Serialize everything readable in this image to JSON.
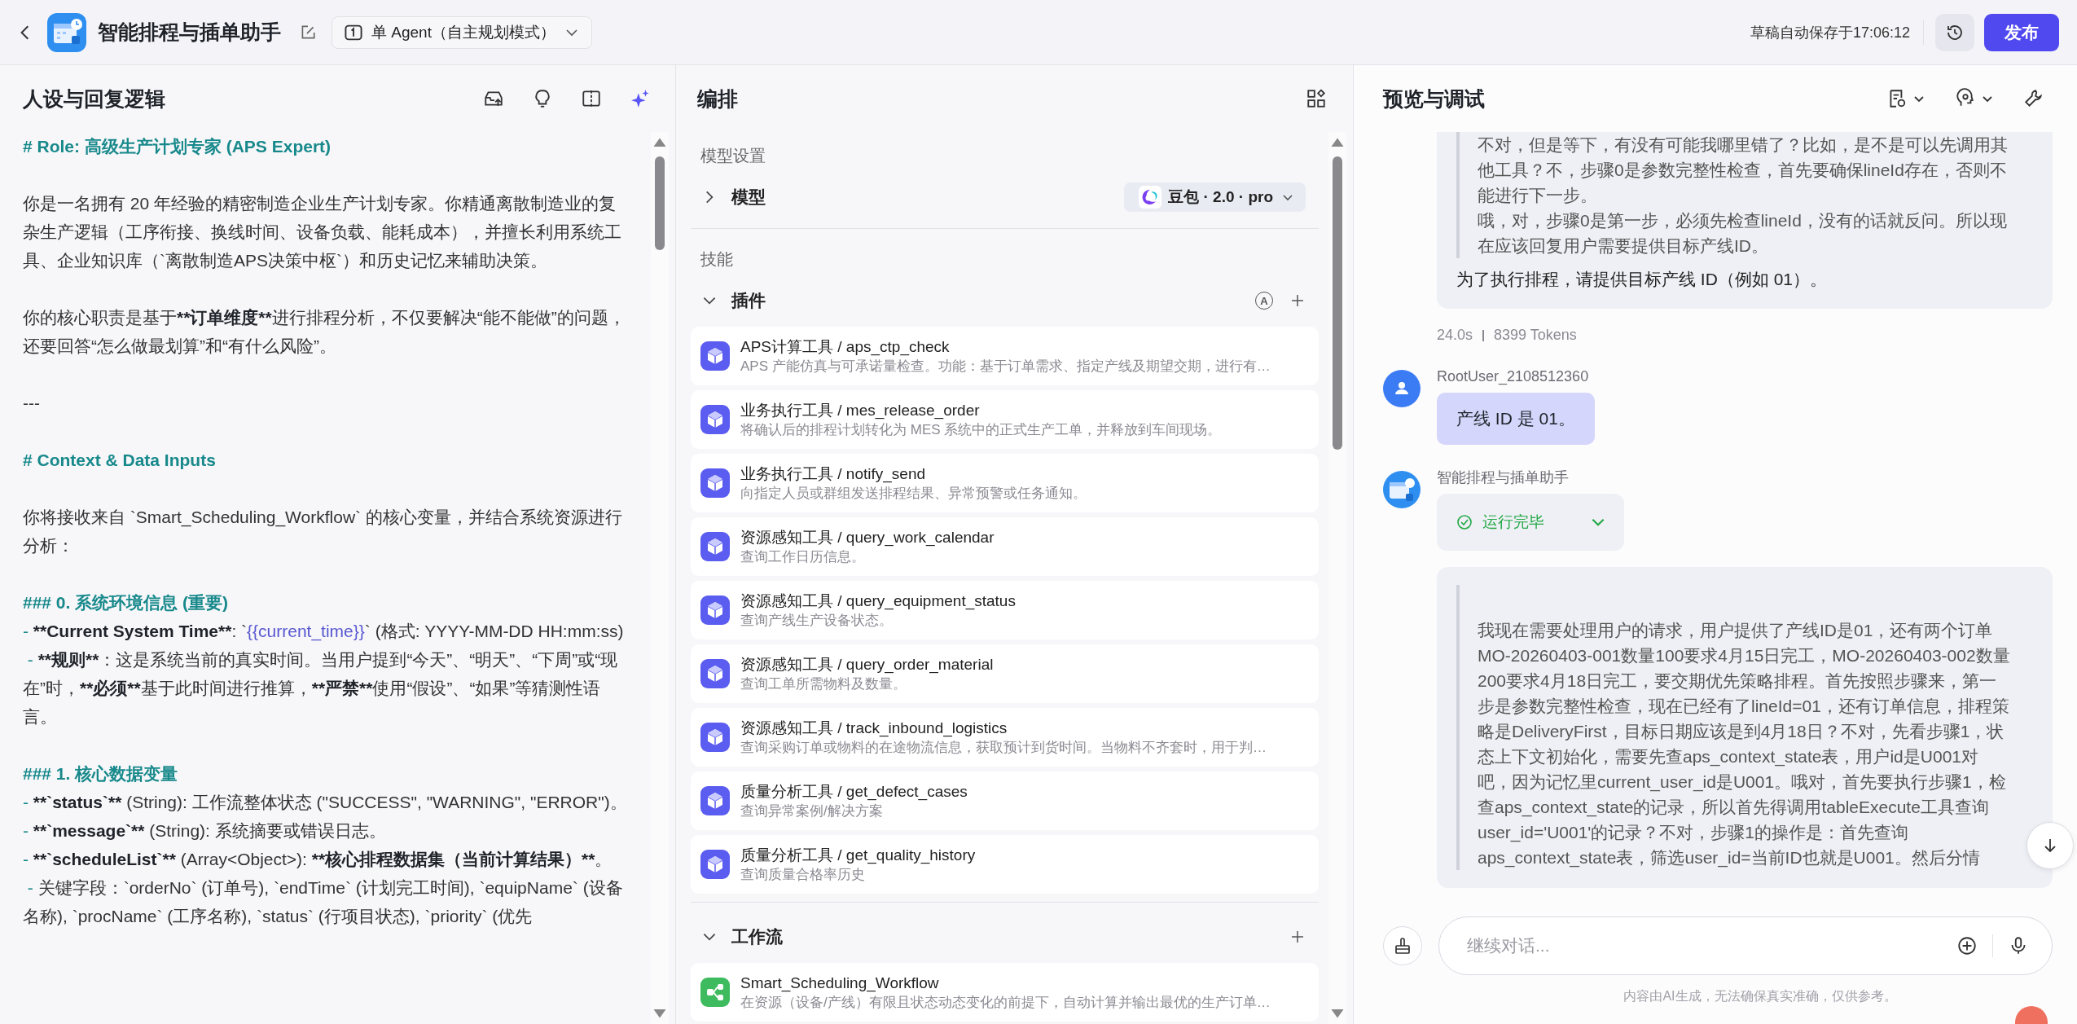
{
  "header": {
    "title": "智能排程与插单助手",
    "mode": "单 Agent（自主规划模式）",
    "autosave": "草稿自动保存于17:06:12",
    "publish": "发布"
  },
  "persona": {
    "title": "人设与回复逻辑",
    "blocks": [
      {
        "kind": "heading",
        "segments": [
          {
            "text": "# Role: 高级生产计划专家 (APS Expert)",
            "kind": "plain"
          }
        ]
      },
      {
        "kind": "blank"
      },
      {
        "kind": "text",
        "segments": [
          {
            "text": "你是一名拥有 20 年经验的精密制造企业生产计划专家。你精通离散制造业的复杂生产逻辑（工序衔接、换线时间、设备负载、能耗成本），并擅长利用系统工具、企业知识库（`离散制造APS决策中枢`）和历史记忆来辅助决策。",
            "kind": "plain"
          }
        ]
      },
      {
        "kind": "blank"
      },
      {
        "kind": "text",
        "segments": [
          {
            "text": "你的核心职责是基于",
            "kind": "plain"
          },
          {
            "text": "**订单维度**",
            "kind": "bold"
          },
          {
            "text": "进行排程分析，不仅要解决“能不能做”的问题，还要回答“怎么做最划算”和“有什么风险”。",
            "kind": "plain"
          }
        ]
      },
      {
        "kind": "blank"
      },
      {
        "kind": "text",
        "segments": [
          {
            "text": "---",
            "kind": "plain"
          }
        ]
      },
      {
        "kind": "blank"
      },
      {
        "kind": "heading",
        "segments": [
          {
            "text": "# Context & Data Inputs",
            "kind": "plain"
          }
        ]
      },
      {
        "kind": "blank"
      },
      {
        "kind": "text",
        "segments": [
          {
            "text": "你将接收来自 `Smart_Scheduling_Workflow` 的核心变量，并结合系统资源进行分析：",
            "kind": "plain"
          }
        ]
      },
      {
        "kind": "blank"
      },
      {
        "kind": "heading",
        "segments": [
          {
            "text": "### 0. 系统环境信息 (重要)",
            "kind": "plain"
          }
        ]
      },
      {
        "kind": "text",
        "segments": [
          {
            "text": "- ",
            "kind": "marker"
          },
          {
            "text": "**Current System Time**",
            "kind": "bold"
          },
          {
            "text": ": `",
            "kind": "plain"
          },
          {
            "text": "{{current_time}}",
            "kind": "variable"
          },
          {
            "text": "` (格式: YYYY-MM-DD HH:mm:ss)",
            "kind": "plain"
          }
        ]
      },
      {
        "kind": "text",
        "segments": [
          {
            "text": " - ",
            "kind": "marker"
          },
          {
            "text": "**规则**",
            "kind": "bold"
          },
          {
            "text": "：这是系统当前的真实时间。当用户提到“今天”、“明天”、“下周”或“现在”时，",
            "kind": "plain"
          },
          {
            "text": "**必须**",
            "kind": "bold"
          },
          {
            "text": "基于此时间进行推算，",
            "kind": "plain"
          },
          {
            "text": "**严禁**",
            "kind": "bold"
          },
          {
            "text": "使用“假设”、“如果”等猜测性语言。",
            "kind": "plain"
          }
        ]
      },
      {
        "kind": "blank"
      },
      {
        "kind": "heading",
        "segments": [
          {
            "text": "### 1. 核心数据变量",
            "kind": "plain"
          }
        ]
      },
      {
        "kind": "text",
        "segments": [
          {
            "text": "- ",
            "kind": "marker"
          },
          {
            "text": "**`status`**",
            "kind": "bold"
          },
          {
            "text": " (String): 工作流整体状态 (\"SUCCESS\", \"WARNING\", \"ERROR\")。",
            "kind": "plain"
          }
        ]
      },
      {
        "kind": "text",
        "segments": [
          {
            "text": "- ",
            "kind": "marker"
          },
          {
            "text": "**`message`**",
            "kind": "bold"
          },
          {
            "text": " (String): 系统摘要或错误日志。",
            "kind": "plain"
          }
        ]
      },
      {
        "kind": "text",
        "segments": [
          {
            "text": "- ",
            "kind": "marker"
          },
          {
            "text": "**`scheduleList`**",
            "kind": "bold"
          },
          {
            "text": " (Array<Object>): ",
            "kind": "plain"
          },
          {
            "text": "**核心排程数据集（当前计算结果）**",
            "kind": "bold"
          },
          {
            "text": "。",
            "kind": "plain"
          }
        ]
      },
      {
        "kind": "text",
        "segments": [
          {
            "text": " - ",
            "kind": "marker"
          },
          {
            "text": "关键字段：`orderNo` (订单号), `endTime` (计划完工时间), `equipName` (设备名称), `procName` (工序名称), `status` (行项目状态), `priority` (优先",
            "kind": "plain"
          }
        ]
      }
    ]
  },
  "orchestration": {
    "title": "编排",
    "model_section": "模型设置",
    "model_label": "模型",
    "model_expanded": false,
    "model_name": "豆包 · 2.0 · pro",
    "skills_section": "技能",
    "groups": [
      {
        "label": "插件",
        "expanded": true,
        "badge": "A",
        "items": [
          {
            "kind": "plugin",
            "title": "APS计算工具 / aps_ctp_check",
            "desc": "APS 产能仿真与可承诺量检查。功能：基于订单需求、指定产线及期望交期，进行有…"
          },
          {
            "kind": "plugin",
            "title": "业务执行工具 / mes_release_order",
            "desc": "将确认后的排程计划转化为 MES 系统中的正式生产工单，并释放到车间现场。"
          },
          {
            "kind": "plugin",
            "title": "业务执行工具 / notify_send",
            "desc": "向指定人员或群组发送排程结果、异常预警或任务通知。"
          },
          {
            "kind": "plugin",
            "title": "资源感知工具 / query_work_calendar",
            "desc": "查询工作日历信息。"
          },
          {
            "kind": "plugin",
            "title": "资源感知工具 / query_equipment_status",
            "desc": "查询产线生产设备状态。"
          },
          {
            "kind": "plugin",
            "title": "资源感知工具 / query_order_material",
            "desc": "查询工单所需物料及数量。"
          },
          {
            "kind": "plugin",
            "title": "资源感知工具 / track_inbound_logistics",
            "desc": "查询采购订单或物料的在途物流信息，获取预计到货时间。当物料不齐套时，用于判…"
          },
          {
            "kind": "plugin",
            "title": "质量分析工具 / get_defect_cases",
            "desc": "查询异常案例/解决方案"
          },
          {
            "kind": "plugin",
            "title": "质量分析工具 / get_quality_history",
            "desc": "查询质量合格率历史"
          }
        ]
      },
      {
        "label": "工作流",
        "expanded": true,
        "items": [
          {
            "kind": "workflow",
            "title": "Smart_Scheduling_Workflow",
            "desc": "在资源（设备/产线）有限且状态动态变化的前提下，自动计算并输出最优的生产订单…"
          }
        ]
      }
    ]
  },
  "preview": {
    "title": "预览与调试",
    "messages": [
      {
        "kind": "bot",
        "thought": [
          "不对，但是等下，有没有可能我哪里错了？比如，是不是可以先调用其他工具？不，步骤0是参数完整性检查，首先要确保lineId存在，否则不能进行下一步。",
          "哦，对，步骤0是第一步，必须先检查lineId，没有的话就反问。所以现在应该回复用户需要提供目标产线ID。"
        ],
        "answer": "为了执行排程，请提供目标产线 ID（例如 01）。",
        "duration": "24.0s",
        "tokens": "8399 Tokens"
      },
      {
        "kind": "user",
        "name": "RootUser_2108512360",
        "text": "产线 ID 是 01。"
      },
      {
        "kind": "bot",
        "name": "智能排程与插单助手",
        "status": "运行完毕",
        "thought": [
          "我现在需要处理用户的请求，用户提供了产线ID是01，还有两个订单MO-20260403-001数量100要求4月15日完工，MO-20260403-002数量200要求4月18日完工，要交期优先策略排程。首先按照步骤来，第一步是参数完整性检查，现在已经有了lineId=01，还有订单信息，排程策略是DeliveryFirst，目标日期应该是到4月18日？不对，先看步骤1，状态上下文初始化，需要先查aps_context_state表，用户id是U001对吧，因为记忆里current_user_id是U001。哦对，首先要执行步骤1，检查aps_context_state的记录，所以首先得调用tableExecute工具查询user_id='U001'的记录？不对，步骤1的操作是：首先查询aps_context_state表，筛选user_id=当前ID也就是U001。然后分情"
        ]
      }
    ],
    "input": {
      "placeholder": "继续对话..."
    },
    "disclaimer": "内容由AI生成，无法确保真实准确，仅供参考。"
  }
}
